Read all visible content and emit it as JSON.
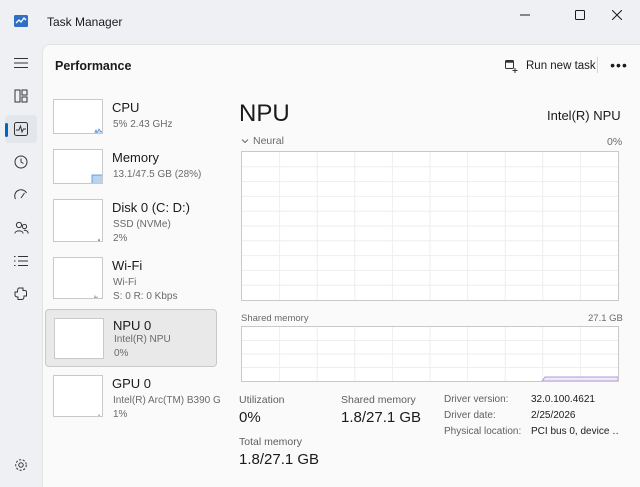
{
  "window": {
    "title": "Task Manager",
    "controls": [
      "minimize-icon",
      "maximize-icon",
      "close-icon"
    ]
  },
  "nav": {
    "items": [
      "hamburger-icon",
      "processes-icon",
      "performance-icon",
      "app-history-icon",
      "startup-apps-icon",
      "users-icon",
      "details-icon",
      "services-icon"
    ],
    "active": "performance-icon",
    "bottom": "settings-icon"
  },
  "header": {
    "page_title": "Performance",
    "run_new_task": "Run new task",
    "more": "•••"
  },
  "resources": [
    {
      "name": "CPU",
      "line1": "5%  2.43 GHz",
      "line2": "",
      "selected": false,
      "color": "#4a8fd4",
      "level": 0.05
    },
    {
      "name": "Memory",
      "line1": "13.1/47.5 GB (28%)",
      "line2": "",
      "selected": false,
      "color": "#4a8fd4",
      "level": 0.28
    },
    {
      "name": "Disk 0 (C: D:)",
      "line1": "SSD (NVMe)",
      "line2": "2%",
      "selected": false,
      "color": "#6aa84f",
      "level": 0.02
    },
    {
      "name": "Wi-Fi",
      "line1": "Wi-Fi",
      "line2": "S: 0  R: 0 Kbps",
      "selected": false,
      "color": "#c27ba0",
      "level": 0.02
    },
    {
      "name": "NPU 0",
      "line1": "Intel(R) NPU",
      "line2": "0%",
      "selected": true,
      "color": "#8e7cc3",
      "level": 0.0
    },
    {
      "name": "GPU 0",
      "line1": "Intel(R) Arc(TM) B390 G…",
      "line2": "1%",
      "selected": false,
      "color": "#8e7cc3",
      "level": 0.01
    }
  ],
  "detail": {
    "title": "NPU",
    "device": "Intel(R) NPU",
    "graph1_label": "Neural",
    "graph1_max": "0%",
    "graph2_label": "Shared memory",
    "graph2_max": "27.1 GB",
    "shared_memory_level": 0.066,
    "stats": {
      "utilization_label": "Utilization",
      "utilization_value": "0%",
      "shared_memory_label": "Shared memory",
      "shared_memory_value": "1.8/27.1 GB",
      "total_memory_label": "Total memory",
      "total_memory_value": "1.8/27.1 GB"
    },
    "info": [
      {
        "label": "Driver version:",
        "value": "32.0.100.4621"
      },
      {
        "label": "Driver date:",
        "value": "2/25/2026"
      },
      {
        "label": "Physical location:",
        "value": "PCI bus 0, device …"
      }
    ]
  },
  "colors": {
    "accent": "#0067c0",
    "npu_line": "#b19cd9",
    "npu_fill": "#eee8f7"
  }
}
